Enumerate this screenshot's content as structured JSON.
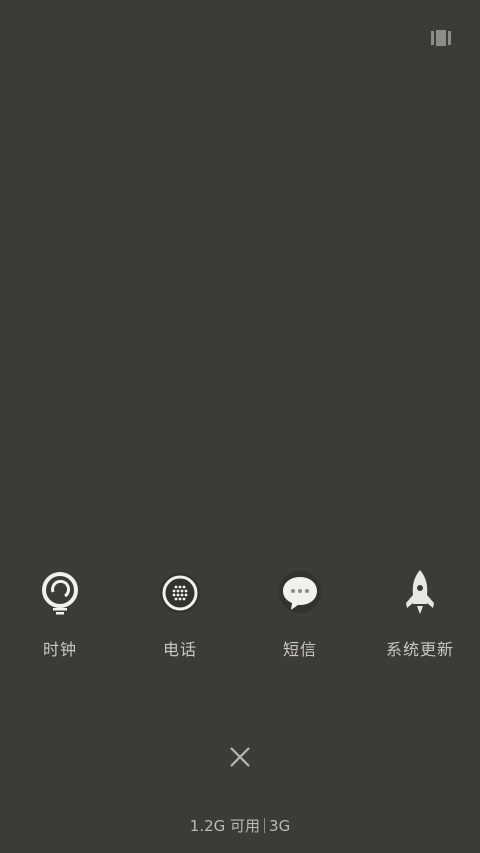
{
  "topbar": {
    "icon": "recents-grid-icon"
  },
  "apps": [
    {
      "label": "时钟",
      "icon": "clock-icon"
    },
    {
      "label": "电话",
      "icon": "phone-icon"
    },
    {
      "label": "短信",
      "icon": "message-icon"
    },
    {
      "label": "系统更新",
      "icon": "rocket-icon"
    }
  ],
  "close": {
    "icon": "close-icon"
  },
  "memory": {
    "available": "1.2G 可用",
    "total": "3G"
  },
  "colors": {
    "background": "#3d3b37",
    "text": "#c9c7c3"
  }
}
